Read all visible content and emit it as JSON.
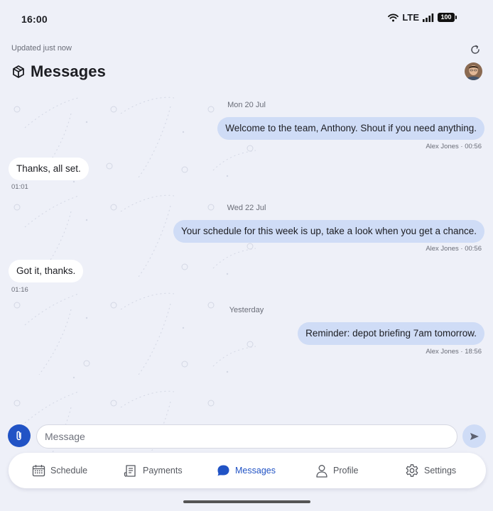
{
  "status_bar": {
    "time": "16:00",
    "network": "LTE",
    "battery": "100"
  },
  "header": {
    "updated_text": "Updated just now",
    "title": "Messages"
  },
  "conversation": [
    {
      "type": "date",
      "text": "Mon 20 Jul"
    },
    {
      "type": "outgoing",
      "text": "Welcome to the team, Anthony. Shout if you need anything.",
      "meta": "Alex Jones · 00:56"
    },
    {
      "type": "incoming",
      "text": "Thanks, all set.",
      "meta": "01:01"
    },
    {
      "type": "date",
      "text": "Wed 22 Jul"
    },
    {
      "type": "outgoing",
      "text": "Your schedule for this week is up, take a look when you get a chance.",
      "meta": "Alex Jones · 00:56"
    },
    {
      "type": "incoming",
      "text": "Got it, thanks.",
      "meta": "01:16"
    },
    {
      "type": "date",
      "text": "Yesterday"
    },
    {
      "type": "outgoing",
      "text": "Reminder: depot briefing 7am tomorrow.",
      "meta": "Alex Jones · 18:56"
    }
  ],
  "composer": {
    "placeholder": "Message"
  },
  "nav": [
    {
      "label": "Schedule",
      "icon": "calendar-icon",
      "active": false
    },
    {
      "label": "Payments",
      "icon": "receipt-icon",
      "active": false
    },
    {
      "label": "Messages",
      "icon": "chat-bubble-icon",
      "active": true
    },
    {
      "label": "Profile",
      "icon": "person-icon",
      "active": false
    },
    {
      "label": "Settings",
      "icon": "gear-icon",
      "active": false
    }
  ],
  "colors": {
    "accent": "#2153c5",
    "outgoing_bubble": "#cfdcf6",
    "background": "#eef0f8"
  }
}
